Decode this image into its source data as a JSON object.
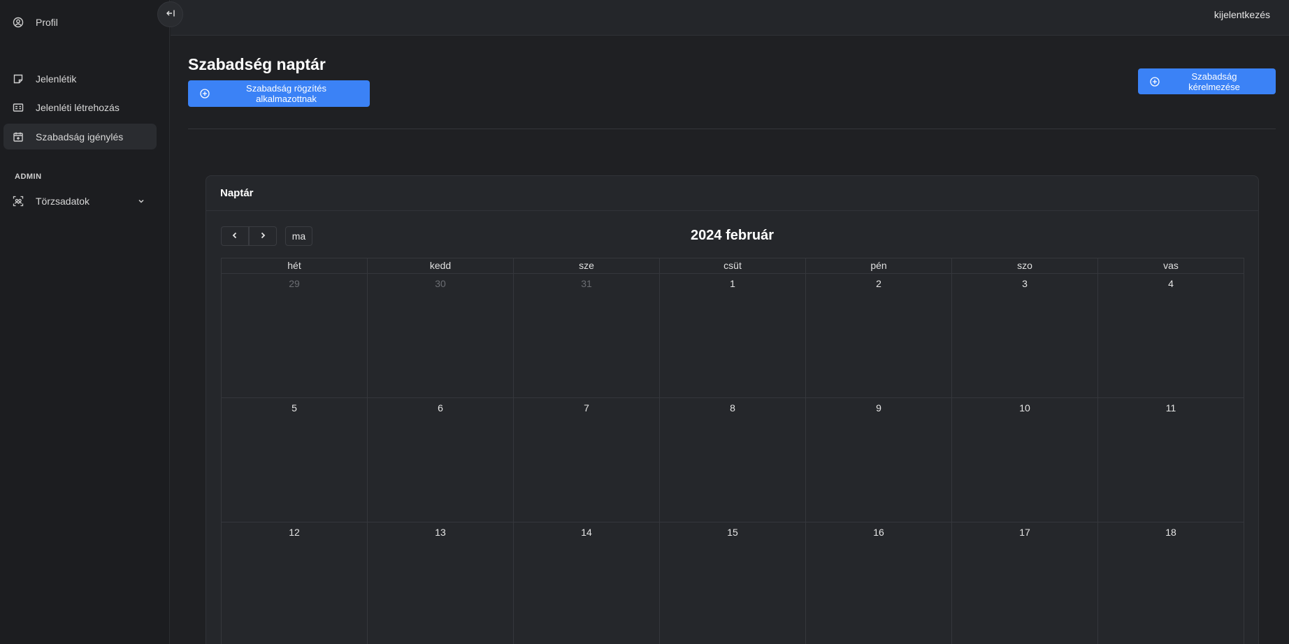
{
  "sidebar": {
    "items": [
      {
        "label": "Profil",
        "icon": "user-circle-icon"
      },
      {
        "label": "Jelenlétik",
        "icon": "sticky-note-icon"
      },
      {
        "label": "Jelenléti létrehozás",
        "icon": "id-card-icon"
      },
      {
        "label": "Szabadság igénylés",
        "icon": "calendar-plus-icon",
        "active": true
      }
    ],
    "section_label": "ADMIN",
    "admin_items": [
      {
        "label": "Törzsadatok",
        "icon": "users-frame-icon"
      }
    ]
  },
  "topbar": {
    "logout_label": "kijelentkezés"
  },
  "main": {
    "title": "Szabadség naptár",
    "record_button_label": "Szabadság rögzítés alkalmazottnak",
    "request_button_label": "Szabadság kérelmezése"
  },
  "calendar": {
    "card_title": "Naptár",
    "today_label": "ma",
    "month_title": "2024 február",
    "weekdays": [
      "hét",
      "kedd",
      "sze",
      "csüt",
      "pén",
      "szo",
      "vas"
    ],
    "weeks": [
      [
        {
          "d": "29",
          "m": true
        },
        {
          "d": "30",
          "m": true
        },
        {
          "d": "31",
          "m": true
        },
        {
          "d": "1"
        },
        {
          "d": "2"
        },
        {
          "d": "3"
        },
        {
          "d": "4"
        }
      ],
      [
        {
          "d": "5"
        },
        {
          "d": "6"
        },
        {
          "d": "7"
        },
        {
          "d": "8"
        },
        {
          "d": "9"
        },
        {
          "d": "10"
        },
        {
          "d": "11"
        }
      ],
      [
        {
          "d": "12"
        },
        {
          "d": "13"
        },
        {
          "d": "14"
        },
        {
          "d": "15"
        },
        {
          "d": "16"
        },
        {
          "d": "17"
        },
        {
          "d": "18"
        }
      ]
    ]
  },
  "colors": {
    "accent": "#3b82f6",
    "background": "#1f2023",
    "sidebar": "#1c1d20"
  }
}
